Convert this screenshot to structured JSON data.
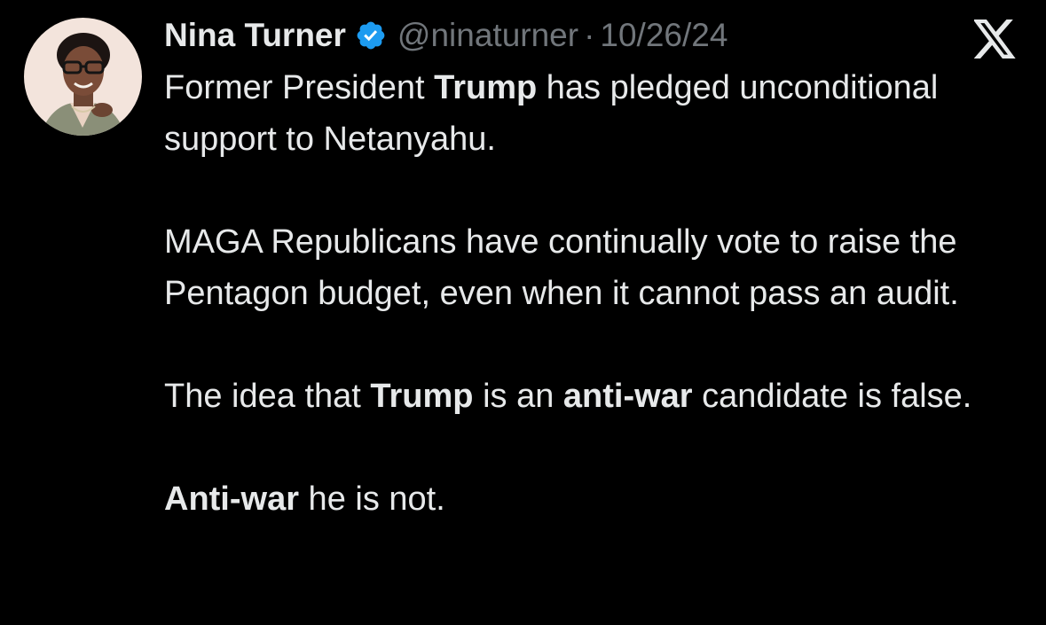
{
  "tweet": {
    "author_name": "Nina Turner",
    "handle": "@ninaturner",
    "separator": "·",
    "date": "10/26/24",
    "verified_color": "#1d9bf0",
    "icons": {
      "verified": "verified-badge-icon",
      "platform": "x-logo-icon"
    },
    "text": {
      "p1_before": "Former President ",
      "p1_bold": "Trump",
      "p1_after": " has pledged unconditional support to Netanyahu.",
      "p2": "MAGA Republicans have continually vote to raise the Pentagon budget, even when it cannot pass an audit.",
      "p3_before": "The idea that ",
      "p3_bold1": "Trump",
      "p3_mid": " is an ",
      "p3_bold2": "anti-war",
      "p3_after": " candidate is false.",
      "p4_bold": "Anti-war",
      "p4_after": " he is not."
    }
  },
  "colors": {
    "background": "#000000",
    "text": "#e7e9ea",
    "muted": "#71767b"
  }
}
